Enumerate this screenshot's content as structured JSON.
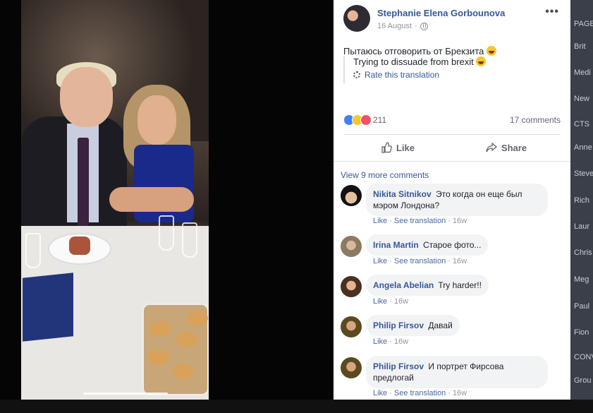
{
  "post": {
    "author": "Stephanie Elena Gorbounova",
    "date": "16 August",
    "more_label": "•••",
    "privacy_icon": "globe-icon",
    "text": "Пытаюсь отговорить от Брекзита",
    "translation": "Trying to dissuade from brexit",
    "rate_translation": "Rate this translation"
  },
  "stats": {
    "reaction_count": "211",
    "comments_count": "17 comments",
    "reactions": [
      "like-icon",
      "haha-icon",
      "love-icon"
    ]
  },
  "actions": {
    "like": "Like",
    "share": "Share"
  },
  "comments_section": {
    "view_more": "View 9 more comments"
  },
  "comments": [
    {
      "name": "Nikita Sitnikov",
      "text_line1": "Это когда он еще был",
      "text_line2": "мэром Лондона?",
      "like": "Like",
      "see_translation": "See translation",
      "time": "16w"
    },
    {
      "name": "Irina Martin",
      "text": "Старое фото...",
      "like": "Like",
      "see_translation": "See translation",
      "time": "16w"
    },
    {
      "name": "Angela Abelian",
      "text": "Try harder!!",
      "like": "Like",
      "time": "16w"
    },
    {
      "name": "Philip Firsov",
      "text": "Давай",
      "like": "Like",
      "time": "16w"
    },
    {
      "name": "Philip Firsov",
      "text_line1": "И портрет Фирсова",
      "text_line2": "предлогай",
      "like": "Like",
      "see_translation": "See translation",
      "time": "16w"
    }
  ],
  "sidebar_right": [
    "PAGES",
    "Brit",
    "Medi",
    "New",
    "CTS",
    "Anne",
    "Steve",
    "Rich",
    "Laur",
    "Chris",
    "Meg",
    "Paul",
    "Fion",
    "CONV",
    "Grou"
  ],
  "colors": {
    "link": "#365899",
    "meta": "#90949c",
    "like_blue": "#4080ff",
    "love_red": "#f25268",
    "haha_yellow": "#f7c52d"
  }
}
